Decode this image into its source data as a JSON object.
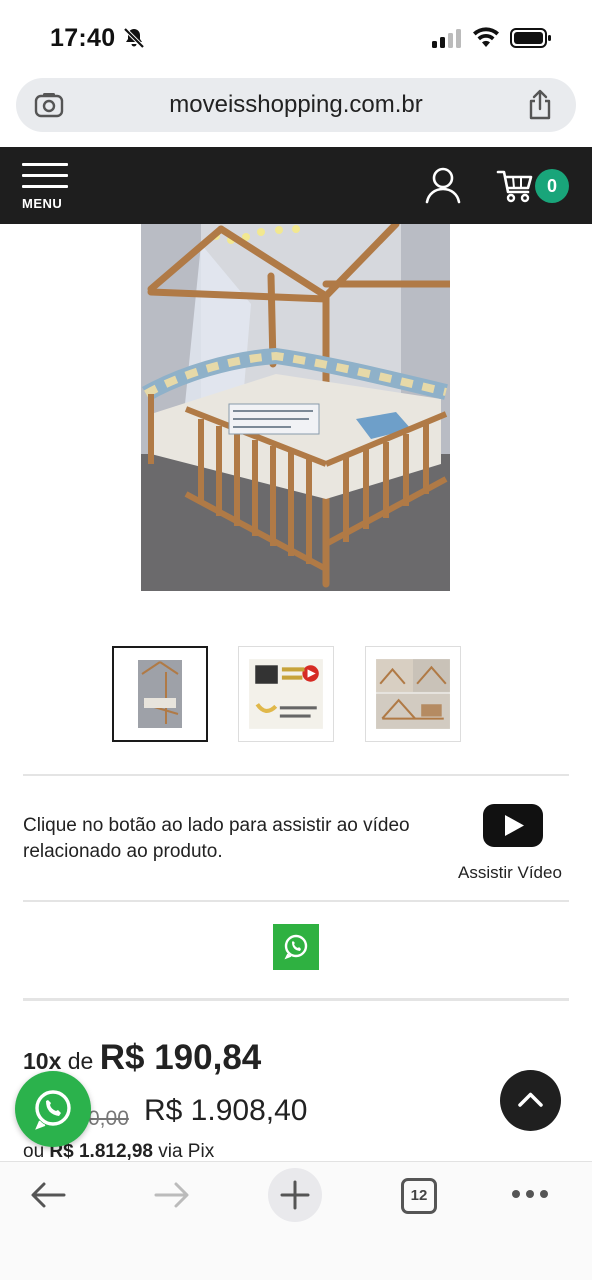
{
  "status_bar": {
    "time": "17:40"
  },
  "browser": {
    "url": "moveisshopping.com.br",
    "open_tabs": "12"
  },
  "header": {
    "menu_label": "MENU",
    "cart_count": "0"
  },
  "gallery": {
    "thumbnails": [
      {
        "name": "thumb-1"
      },
      {
        "name": "thumb-2"
      },
      {
        "name": "thumb-3"
      }
    ]
  },
  "video": {
    "description": "Clique no botão ao lado para assistir ao vídeo relacionado ao produto.",
    "button_label": "Assistir Vídeo"
  },
  "price": {
    "installments_count": "10x",
    "installments_prefix": "de",
    "installment_value": "R$ 190,84",
    "old_price": "0,00",
    "total_price": "R$ 1.908,40",
    "pix_prefix": "ou",
    "pix_price": "R$ 1.812,98",
    "pix_suffix": "via Pix"
  },
  "colors": {
    "header_bg": "#1e1e1e",
    "cart_badge": "#19a57a",
    "whatsapp": "#2bb24c"
  }
}
